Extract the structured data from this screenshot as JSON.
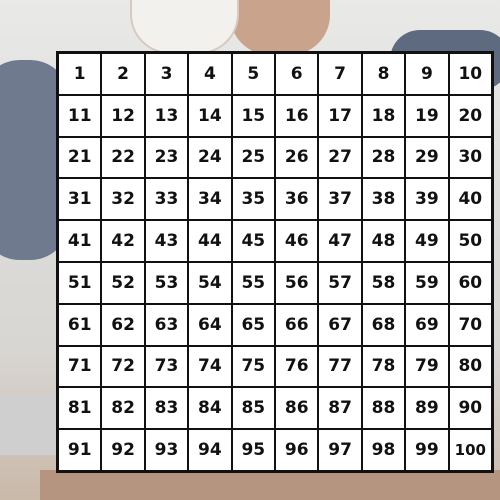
{
  "grid": {
    "cells": [
      1,
      2,
      3,
      4,
      5,
      6,
      7,
      8,
      9,
      10,
      11,
      12,
      13,
      14,
      15,
      16,
      17,
      18,
      19,
      20,
      21,
      22,
      23,
      24,
      25,
      26,
      27,
      28,
      29,
      30,
      31,
      32,
      33,
      34,
      35,
      36,
      37,
      38,
      39,
      40,
      41,
      42,
      43,
      44,
      45,
      46,
      47,
      48,
      49,
      50,
      51,
      52,
      53,
      54,
      55,
      56,
      57,
      58,
      59,
      60,
      61,
      62,
      63,
      64,
      65,
      66,
      67,
      68,
      69,
      70,
      71,
      72,
      73,
      74,
      75,
      76,
      77,
      78,
      79,
      80,
      81,
      82,
      83,
      84,
      85,
      86,
      87,
      88,
      89,
      90,
      91,
      92,
      93,
      94,
      95,
      96,
      97,
      98,
      99,
      100
    ],
    "rows": 10,
    "columns": 10
  },
  "colors": {
    "grid_line": "#111111",
    "cell_background": "#ffffff",
    "text": "#111111"
  }
}
